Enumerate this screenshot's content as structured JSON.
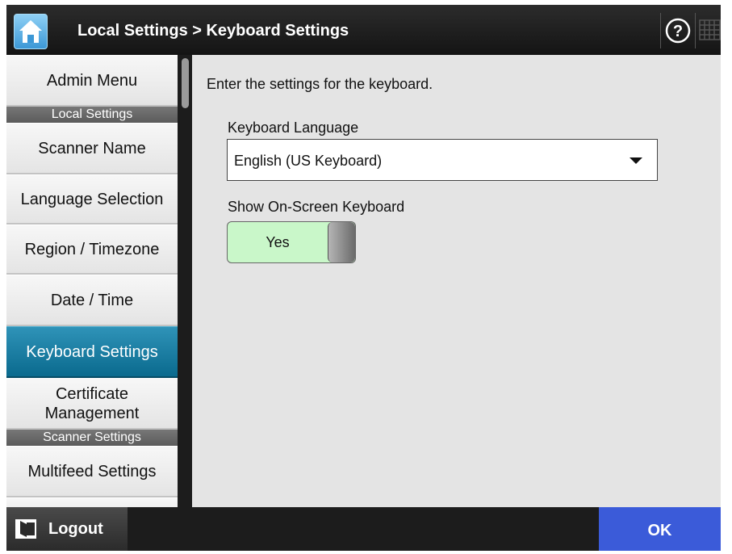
{
  "header": {
    "title": "Local Settings > Keyboard Settings",
    "home_icon": "home-icon",
    "help_icon": "help-icon",
    "keyboard_icon": "keyboard-icon"
  },
  "sidebar": {
    "items": [
      {
        "label": "Admin Menu"
      },
      {
        "label": "Local Settings"
      },
      {
        "label": "Scanner Name"
      },
      {
        "label": "Language Selection"
      },
      {
        "label": "Region / Timezone"
      },
      {
        "label": "Date / Time"
      },
      {
        "label": "Keyboard Settings",
        "active": true
      },
      {
        "label": "Certificate Management"
      },
      {
        "label": "Scanner Settings"
      },
      {
        "label": "Multifeed Settings"
      }
    ]
  },
  "main": {
    "instruction": "Enter the settings for the keyboard.",
    "keyboard_language": {
      "label": "Keyboard Language",
      "value": "English (US Keyboard)"
    },
    "on_screen_keyboard": {
      "label": "Show On-Screen Keyboard",
      "value": "Yes"
    }
  },
  "footer": {
    "logout_label": "Logout",
    "ok_label": "OK"
  },
  "colors": {
    "active_item": "#0a6a8e",
    "ok_button": "#3b5bd9",
    "toggle_on": "#c9f7c9",
    "title_bar": "#1c1c1c"
  }
}
